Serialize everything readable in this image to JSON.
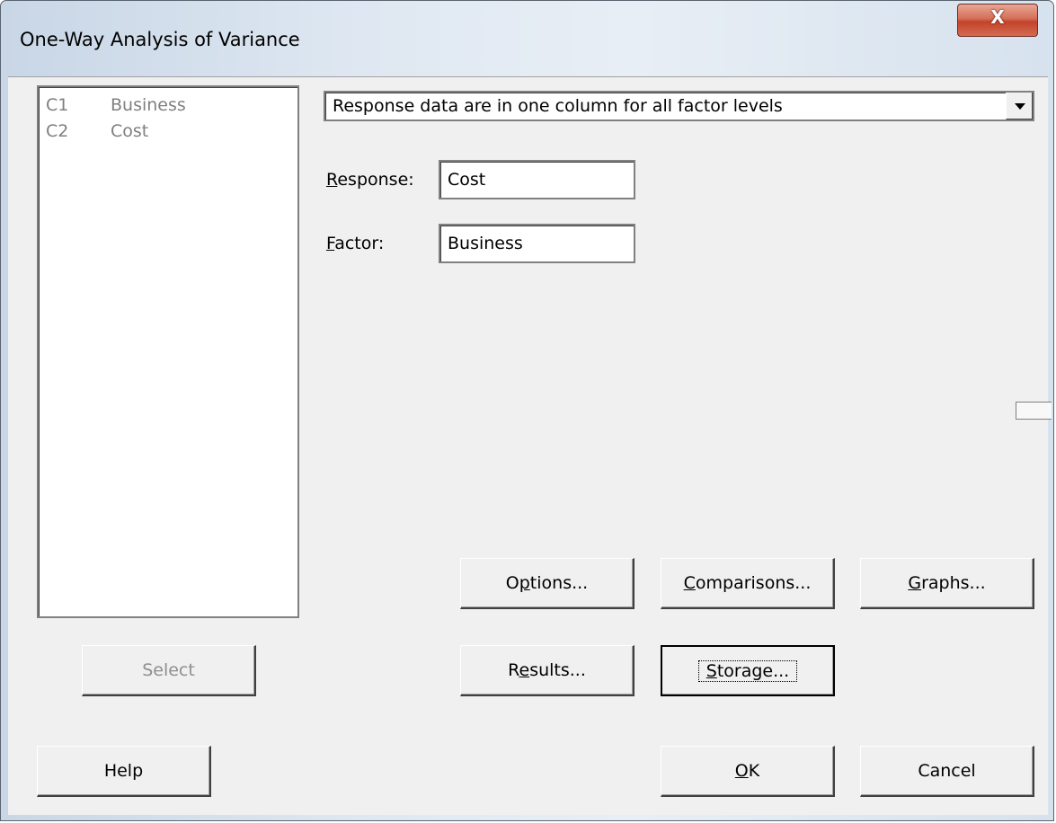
{
  "window": {
    "title": "One-Way Analysis of Variance",
    "close_label": "X"
  },
  "variables": [
    {
      "col": "C1",
      "name": "Business"
    },
    {
      "col": "C2",
      "name": "Cost"
    }
  ],
  "layout_select": {
    "value": "Response data are in one column for all factor levels"
  },
  "response": {
    "label": "Response:",
    "value": "Cost"
  },
  "factor": {
    "label": "Factor:",
    "value": "Business"
  },
  "buttons": {
    "select": "Select",
    "options": "Options...",
    "comparisons": "Comparisons...",
    "graphs": "Graphs...",
    "results": "Results...",
    "storage": "Storage...",
    "help": "Help",
    "ok": "OK",
    "cancel": "Cancel"
  }
}
